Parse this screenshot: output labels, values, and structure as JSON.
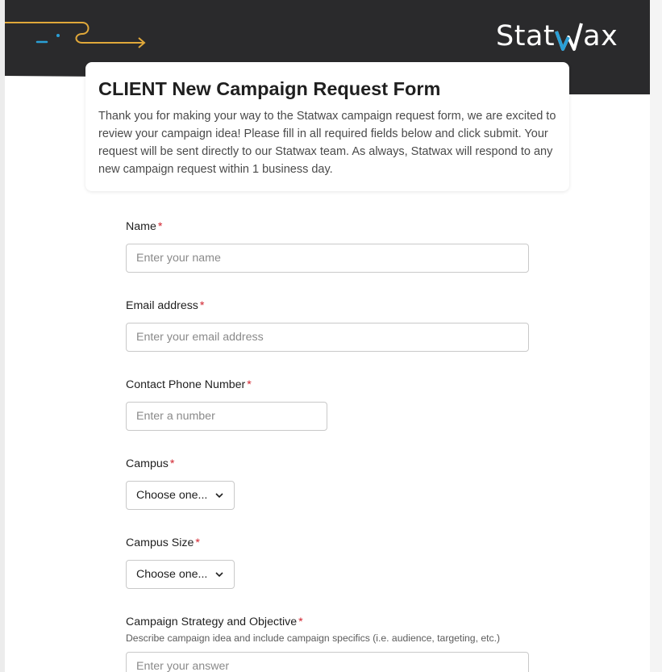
{
  "header": {
    "brand": {
      "prefix": "Stat",
      "suffix": "ax"
    },
    "colors": {
      "dark": "#2a2a2c",
      "accent_gold": "#e0a83a",
      "accent_blue": "#2a9fd6"
    }
  },
  "form": {
    "title": "CLIENT New Campaign Request Form",
    "description": "Thank you for making your way to the Statwax campaign request form, we are excited to review your campaign idea! Please fill in all required fields below and click submit. Your request will be sent directly to our Statwax team. As always, Statwax will respond to any new campaign request within 1 business day.",
    "required_marker": "*",
    "fields": {
      "name": {
        "label": "Name",
        "placeholder": "Enter your name"
      },
      "email": {
        "label": "Email address",
        "placeholder": "Enter your email address"
      },
      "phone": {
        "label": "Contact Phone Number",
        "placeholder": "Enter a number"
      },
      "campus": {
        "label": "Campus",
        "selected": "Choose one..."
      },
      "campus_size": {
        "label": "Campus Size",
        "selected": "Choose one..."
      },
      "strategy": {
        "label": "Campaign Strategy and Objective",
        "help": "Describe campaign idea and include campaign specifics (i.e. audience, targeting, etc.)",
        "placeholder": "Enter your answer"
      }
    }
  }
}
